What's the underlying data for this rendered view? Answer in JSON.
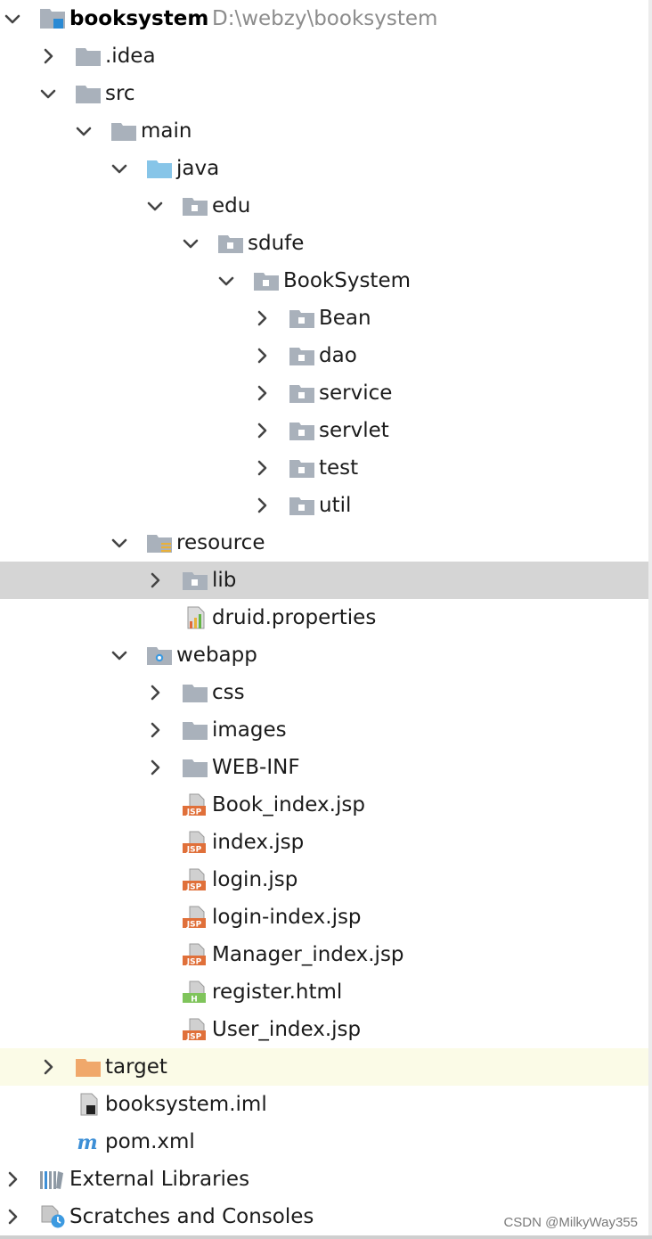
{
  "project": {
    "name": "booksystem",
    "path": "D:\\webzy\\booksystem"
  },
  "tree": {
    "idea": ".idea",
    "src": "src",
    "main": "main",
    "java": "java",
    "edu": "edu",
    "sdufe": "sdufe",
    "booksystem_pkg": "BookSystem",
    "bean": "Bean",
    "dao": "dao",
    "service": "service",
    "servlet": "servlet",
    "test": "test",
    "util": "util",
    "resource": "resource",
    "lib": "lib",
    "druid": "druid.properties",
    "webapp": "webapp",
    "css": "css",
    "images": "images",
    "webinf": "WEB-INF",
    "book_index": "Book_index.jsp",
    "index": "index.jsp",
    "login": "login.jsp",
    "login_index": "login-index.jsp",
    "manager_index": "Manager_index.jsp",
    "register": "register.html",
    "user_index": "User_index.jsp",
    "target": "target",
    "iml": "booksystem.iml",
    "pom": "pom.xml",
    "external_libraries": "External Libraries",
    "scratches": "Scratches and Consoles"
  },
  "watermark": "CSDN @MilkyWay355",
  "colors": {
    "selected_row": "#d5d5d5",
    "excluded_row": "#fbfbe7",
    "folder": "#a9b1bb",
    "source_folder": "#87c5e8",
    "excluded_folder": "#f0a86b",
    "jsp": "#e0703a"
  }
}
